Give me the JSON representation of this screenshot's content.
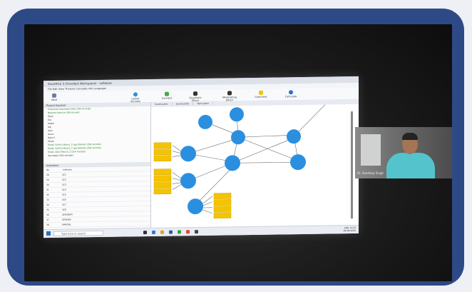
{
  "app": {
    "title": "SmartPLS 3 (Smartpls Workspace) - software",
    "menu": "File  Edit  View  Themes  Calculate  Info  Language"
  },
  "toolbar": {
    "buttons": [
      "Save",
      "Latent Variable",
      "Connect",
      "Quadratic Effect",
      "Moderating Effect",
      "Comment",
      "Calculate"
    ]
  },
  "explorer": {
    "header": "Project Explorer",
    "rows": [
      {
        "text": "Corporate reputation data (344 records)",
        "green": true
      },
      {
        "text": "Network data.txt (98 records)",
        "green": true
      },
      {
        "text": "Team",
        "green": false
      },
      {
        "text": "Eks",
        "green": false
      },
      {
        "text": "Model",
        "green": false
      },
      {
        "text": "Adj",
        "green": false
      },
      {
        "text": "Item",
        "green": false
      },
      {
        "text": "Items",
        "green": false
      },
      {
        "text": "Data-5",
        "green": false
      },
      {
        "text": "Fitted",
        "green": false
      },
      {
        "text": "Fitted. SmPLS Mis/v5_2 (part/dome) (294 records)",
        "green": true
      },
      {
        "text": "Fitted. SmPLS Mis/v5_2 (part/dome) (294 records)",
        "green": true
      },
      {
        "text": "Fitted. 2024 Mis/v5_2 (254 records)",
        "green": true
      },
      {
        "text": "See steps (254 records)",
        "green": false
      }
    ]
  },
  "indicators": {
    "header": "Indicators",
    "columns": [
      "No.",
      "Indicator"
    ],
    "rows": [
      [
        "28",
        "SC1"
      ],
      [
        "29",
        "SC2"
      ],
      [
        "30",
        "SC3"
      ],
      [
        "31",
        "SC4"
      ],
      [
        "32",
        "SC5"
      ],
      [
        "33",
        "SC6"
      ],
      [
        "34",
        "SC7"
      ],
      [
        "35",
        "SC8"
      ],
      [
        "36",
        "SERVDEM"
      ],
      [
        "37",
        "GENDER"
      ],
      [
        "38",
        "MARITAL"
      ]
    ]
  },
  "canvas": {
    "tabs": [
      "Saved paths",
      "Saved paths",
      "Yap1.splsm"
    ]
  },
  "taskbar": {
    "search_placeholder": "Type here to search",
    "time": "11:22",
    "date": "28-08-2020",
    "lang": "ENG"
  },
  "video": {
    "participant": "Dr. Sandeep Singh"
  },
  "colors": {
    "frame": "#2e4a86",
    "node": "#2b8fe0",
    "indicator": "#f4c400",
    "video_shirt": "#54c3cc"
  }
}
